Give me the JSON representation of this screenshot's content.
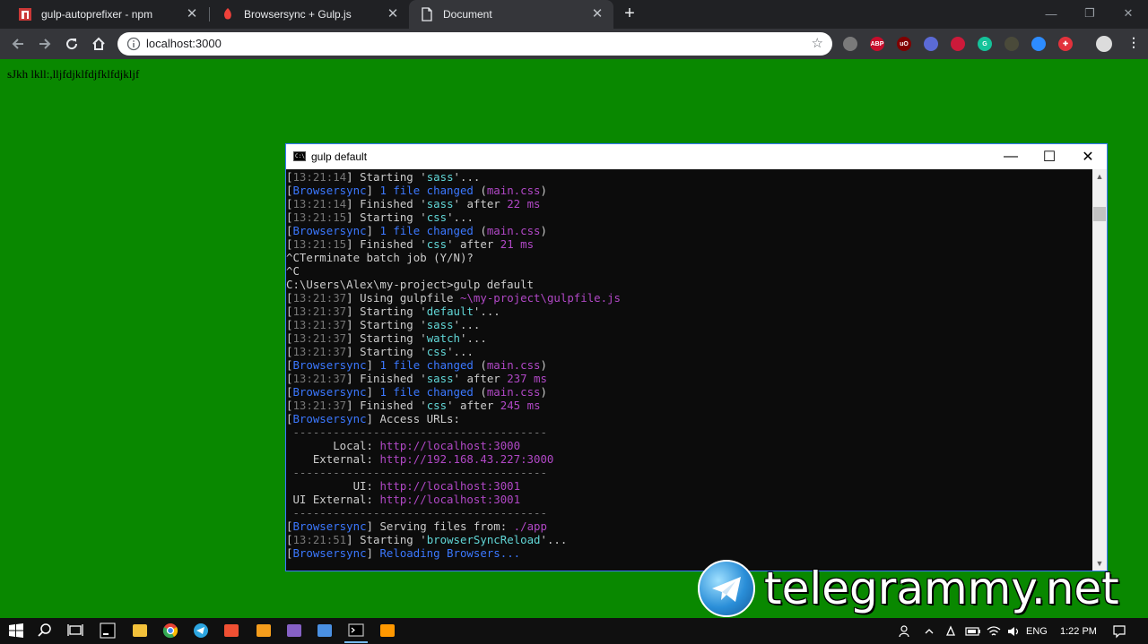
{
  "browser": {
    "tabs": [
      {
        "title": "gulp-autoprefixer - npm",
        "favicon": "npm-icon",
        "active": false
      },
      {
        "title": "Browsersync + Gulp.js",
        "favicon": "browsersync-icon",
        "active": false
      },
      {
        "title": "Document",
        "favicon": "document-icon",
        "active": true
      }
    ],
    "new_tab": "+",
    "window_controls": [
      "—",
      "❐",
      "✕"
    ],
    "url": "localhost:3000",
    "extensions": [
      {
        "name": "paw-extension-icon",
        "color": "#7a7a7a",
        "label": ""
      },
      {
        "name": "adblock-plus-icon",
        "color": "#c70d2c",
        "label": "ABP"
      },
      {
        "name": "ublock-origin-icon",
        "color": "#800000",
        "label": "uO"
      },
      {
        "name": "shield-extension-icon",
        "color": "#5b6ad6",
        "label": ""
      },
      {
        "name": "red-circle-extension-icon",
        "color": "#cc1a3a",
        "label": ""
      },
      {
        "name": "grammarly-icon",
        "color": "#15c39a",
        "label": "G"
      },
      {
        "name": "dark-extension-icon",
        "color": "#4a4a3a",
        "label": ""
      },
      {
        "name": "zoom-extension-icon",
        "color": "#2d8cff",
        "label": ""
      },
      {
        "name": "plus-extension-icon",
        "color": "#e2323c",
        "label": "✚"
      },
      {
        "name": "profile-avatar-icon",
        "color": "#dcdcdc",
        "label": ""
      }
    ]
  },
  "page": {
    "text": "sJkh lkll:,lljfdjklfdjfklfdjkljf"
  },
  "console": {
    "title": "gulp default",
    "controls": [
      "—",
      "☐",
      "✕"
    ],
    "lines": [
      [
        [
          "[",
          "c-white"
        ],
        [
          "13:21:14",
          "c-gray"
        ],
        [
          "] Starting '",
          "c-white"
        ],
        [
          "sass",
          "c-cyan"
        ],
        [
          "'...",
          "c-white"
        ]
      ],
      [
        [
          "[",
          "c-white"
        ],
        [
          "Browsersync",
          "c-blue"
        ],
        [
          "] ",
          "c-white"
        ],
        [
          "1 file changed",
          "c-blue"
        ],
        [
          " (",
          "c-white"
        ],
        [
          "main.css",
          "c-mag"
        ],
        [
          ")",
          "c-white"
        ]
      ],
      [
        [
          "[",
          "c-white"
        ],
        [
          "13:21:14",
          "c-gray"
        ],
        [
          "] Finished '",
          "c-white"
        ],
        [
          "sass",
          "c-cyan"
        ],
        [
          "' after ",
          "c-white"
        ],
        [
          "22 ms",
          "c-mag"
        ]
      ],
      [
        [
          "[",
          "c-white"
        ],
        [
          "13:21:15",
          "c-gray"
        ],
        [
          "] Starting '",
          "c-white"
        ],
        [
          "css",
          "c-cyan"
        ],
        [
          "'...",
          "c-white"
        ]
      ],
      [
        [
          "[",
          "c-white"
        ],
        [
          "Browsersync",
          "c-blue"
        ],
        [
          "] ",
          "c-white"
        ],
        [
          "1 file changed",
          "c-blue"
        ],
        [
          " (",
          "c-white"
        ],
        [
          "main.css",
          "c-mag"
        ],
        [
          ")",
          "c-white"
        ]
      ],
      [
        [
          "[",
          "c-white"
        ],
        [
          "13:21:15",
          "c-gray"
        ],
        [
          "] Finished '",
          "c-white"
        ],
        [
          "css",
          "c-cyan"
        ],
        [
          "' after ",
          "c-white"
        ],
        [
          "21 ms",
          "c-mag"
        ]
      ],
      [
        [
          "^CTerminate batch job (Y/N)?",
          "c-white"
        ]
      ],
      [
        [
          "^C",
          "c-white"
        ]
      ],
      [
        [
          "C:\\Users\\Alex\\my-project>gulp default",
          "c-white"
        ]
      ],
      [
        [
          "[",
          "c-white"
        ],
        [
          "13:21:37",
          "c-gray"
        ],
        [
          "] Using gulpfile ",
          "c-white"
        ],
        [
          "~\\my-project\\gulpfile.js",
          "c-mag"
        ]
      ],
      [
        [
          "[",
          "c-white"
        ],
        [
          "13:21:37",
          "c-gray"
        ],
        [
          "] Starting '",
          "c-white"
        ],
        [
          "default",
          "c-cyan"
        ],
        [
          "'...",
          "c-white"
        ]
      ],
      [
        [
          "[",
          "c-white"
        ],
        [
          "13:21:37",
          "c-gray"
        ],
        [
          "] Starting '",
          "c-white"
        ],
        [
          "sass",
          "c-cyan"
        ],
        [
          "'...",
          "c-white"
        ]
      ],
      [
        [
          "[",
          "c-white"
        ],
        [
          "13:21:37",
          "c-gray"
        ],
        [
          "] Starting '",
          "c-white"
        ],
        [
          "watch",
          "c-cyan"
        ],
        [
          "'...",
          "c-white"
        ]
      ],
      [
        [
          "[",
          "c-white"
        ],
        [
          "13:21:37",
          "c-gray"
        ],
        [
          "] Starting '",
          "c-white"
        ],
        [
          "css",
          "c-cyan"
        ],
        [
          "'...",
          "c-white"
        ]
      ],
      [
        [
          "[",
          "c-white"
        ],
        [
          "Browsersync",
          "c-blue"
        ],
        [
          "] ",
          "c-white"
        ],
        [
          "1 file changed",
          "c-blue"
        ],
        [
          " (",
          "c-white"
        ],
        [
          "main.css",
          "c-mag"
        ],
        [
          ")",
          "c-white"
        ]
      ],
      [
        [
          "[",
          "c-white"
        ],
        [
          "13:21:37",
          "c-gray"
        ],
        [
          "] Finished '",
          "c-white"
        ],
        [
          "sass",
          "c-cyan"
        ],
        [
          "' after ",
          "c-white"
        ],
        [
          "237 ms",
          "c-mag"
        ]
      ],
      [
        [
          "[",
          "c-white"
        ],
        [
          "Browsersync",
          "c-blue"
        ],
        [
          "] ",
          "c-white"
        ],
        [
          "1 file changed",
          "c-blue"
        ],
        [
          " (",
          "c-white"
        ],
        [
          "main.css",
          "c-mag"
        ],
        [
          ")",
          "c-white"
        ]
      ],
      [
        [
          "[",
          "c-white"
        ],
        [
          "13:21:37",
          "c-gray"
        ],
        [
          "] Finished '",
          "c-white"
        ],
        [
          "css",
          "c-cyan"
        ],
        [
          "' after ",
          "c-white"
        ],
        [
          "245 ms",
          "c-mag"
        ]
      ],
      [
        [
          "[",
          "c-white"
        ],
        [
          "Browsersync",
          "c-blue"
        ],
        [
          "] Access URLs:",
          "c-white"
        ]
      ],
      [
        [
          " --------------------------------------",
          "sep"
        ]
      ],
      [
        [
          "       Local: ",
          "c-white"
        ],
        [
          "http://localhost:3000",
          "c-mag"
        ]
      ],
      [
        [
          "    External: ",
          "c-white"
        ],
        [
          "http://192.168.43.227:3000",
          "c-mag"
        ]
      ],
      [
        [
          " --------------------------------------",
          "sep"
        ]
      ],
      [
        [
          "          UI: ",
          "c-white"
        ],
        [
          "http://localhost:3001",
          "c-mag"
        ]
      ],
      [
        [
          " UI External: ",
          "c-white"
        ],
        [
          "http://localhost:3001",
          "c-mag"
        ]
      ],
      [
        [
          " --------------------------------------",
          "sep"
        ]
      ],
      [
        [
          "[",
          "c-white"
        ],
        [
          "Browsersync",
          "c-blue"
        ],
        [
          "] Serving files from: ",
          "c-white"
        ],
        [
          "./app",
          "c-mag"
        ]
      ],
      [
        [
          "[",
          "c-white"
        ],
        [
          "13:21:51",
          "c-gray"
        ],
        [
          "] Starting '",
          "c-white"
        ],
        [
          "browserSyncReload",
          "c-cyan"
        ],
        [
          "'...",
          "c-white"
        ]
      ],
      [
        [
          "[",
          "c-white"
        ],
        [
          "Browsersync",
          "c-blue"
        ],
        [
          "] ",
          "c-white"
        ],
        [
          "Reloading Browsers...",
          "c-blue"
        ]
      ]
    ]
  },
  "watermark": {
    "text": "telegrammy.net"
  },
  "taskbar": {
    "apps": [
      {
        "name": "start-button",
        "color": "#ffffff"
      },
      {
        "name": "search-taskbar-icon",
        "color": "#ffffff"
      },
      {
        "name": "task-view-icon",
        "color": "#ffffff"
      },
      {
        "name": "jetbrains-app-icon",
        "color": "#ffffff"
      },
      {
        "name": "file-explorer-icon",
        "color": "#f3c13a"
      },
      {
        "name": "chrome-app-icon",
        "color": "#e94235"
      },
      {
        "name": "telegram-app-icon",
        "color": "#2ca5e0"
      },
      {
        "name": "git-app-icon",
        "color": "#f05033"
      },
      {
        "name": "orange-app-icon",
        "color": "#f59d1c"
      },
      {
        "name": "visual-studio-app-icon",
        "color": "#8661c5"
      },
      {
        "name": "blue-circle-app-icon",
        "color": "#4a90e2"
      },
      {
        "name": "command-prompt-app-icon",
        "color": "#c0c0c0"
      },
      {
        "name": "sublime-text-app-icon",
        "color": "#ff9800"
      }
    ],
    "language": "ENG",
    "time": "1:22 PM"
  }
}
